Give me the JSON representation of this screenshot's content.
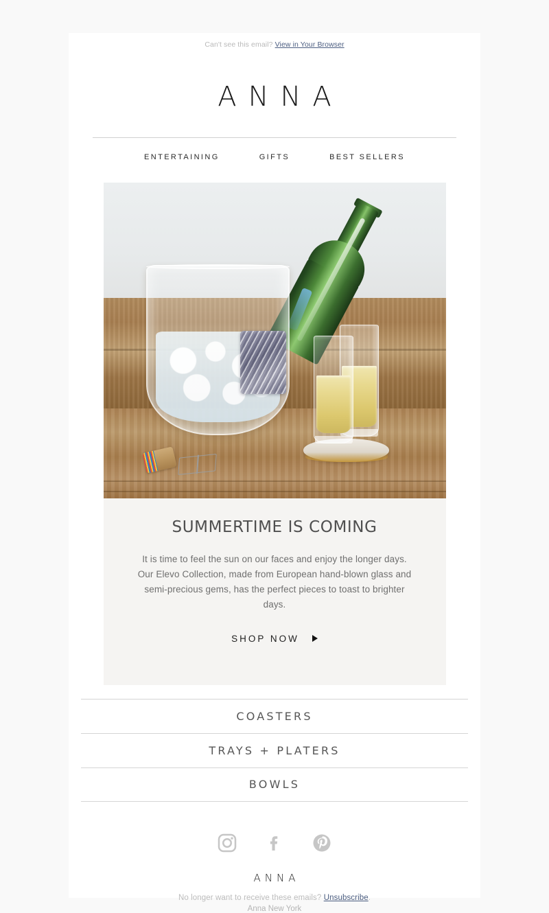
{
  "preheader": {
    "text": "Can't see this email?",
    "link_label": "View in Your Browser"
  },
  "header": {
    "logo": "ANNA",
    "nav": [
      {
        "label": "ENTERTAINING",
        "name": "entertaining"
      },
      {
        "label": "GIFTS",
        "name": "gifts"
      },
      {
        "label": "BEST SELLERS",
        "name": "best-sellers"
      }
    ]
  },
  "hero": {
    "alt": "Champagne bottle chilling in a glass ice bucket with an agate accent beside two champagne flutes on an agate coaster, on a rustic wood table"
  },
  "main": {
    "headline": "SUMMERTIME IS COMING",
    "body": "It is time to feel the sun on our faces and enjoy the longer days. Our Elevo Collection, made from European hand-blown glass and semi-precious gems, has the perfect pieces to toast to brighter days.",
    "cta_label": "SHOP NOW"
  },
  "categories": [
    {
      "label": "COASTERS",
      "name": "coasters"
    },
    {
      "label": "TRAYS + PLATERS",
      "name": "trays-platers"
    },
    {
      "label": "BOWLS",
      "name": "bowls"
    }
  ],
  "social": [
    {
      "name": "instagram",
      "label": "Instagram"
    },
    {
      "name": "facebook",
      "label": "Facebook"
    },
    {
      "name": "pinterest",
      "label": "Pinterest"
    }
  ],
  "footer": {
    "logo": "ANNA",
    "unsubscribe_prefix": "No longer want to receive these emails?",
    "unsubscribe_label": "Unsubscribe",
    "unsubscribe_suffix": ".",
    "address": "Anna New York"
  },
  "colors": {
    "page_background": "#f9f9f9",
    "card_background": "#ffffff",
    "panel_background": "#f5f4f2",
    "link": "#4b5d80",
    "muted_text": "#bdbdbd",
    "heading": "#4f4f4f",
    "social_icon": "#c6c6c6",
    "divider": "#d5d5d5"
  }
}
